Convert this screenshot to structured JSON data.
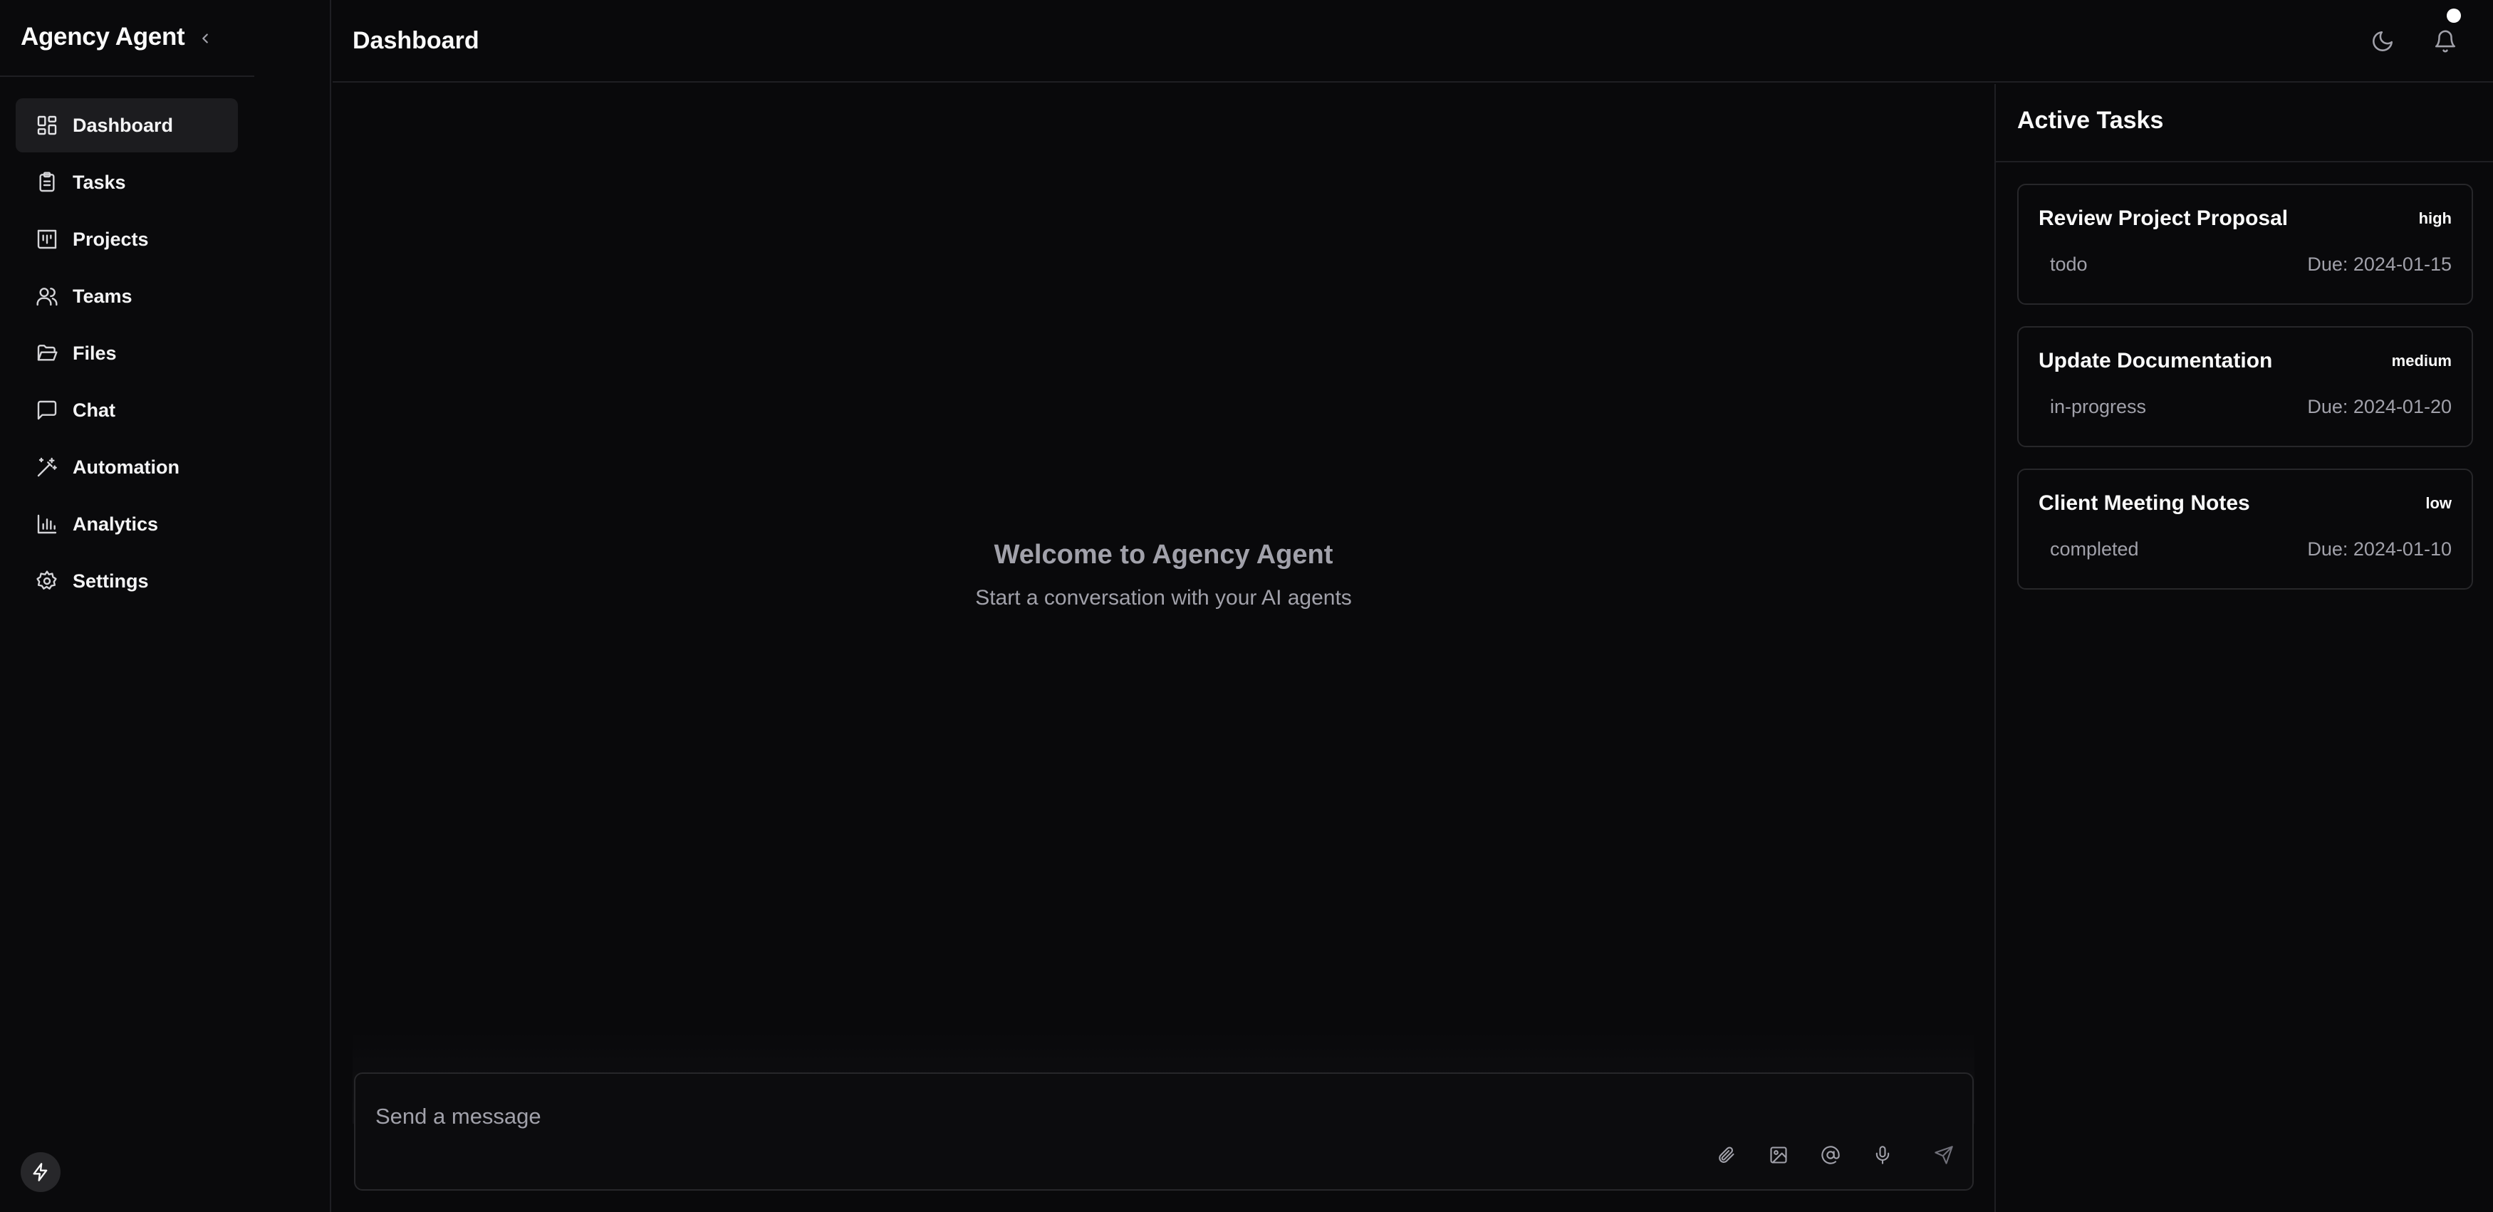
{
  "sidebar": {
    "app_name": "Agency Agent",
    "items": [
      {
        "label": "Dashboard",
        "icon": "layout-dashboard-icon",
        "active": true
      },
      {
        "label": "Tasks",
        "icon": "clipboard-list-icon"
      },
      {
        "label": "Projects",
        "icon": "kanban-chart-icon"
      },
      {
        "label": "Teams",
        "icon": "users-icon"
      },
      {
        "label": "Files",
        "icon": "folder-open-icon"
      },
      {
        "label": "Chat",
        "icon": "message-square-icon"
      },
      {
        "label": "Automation",
        "icon": "wand-icon"
      },
      {
        "label": "Analytics",
        "icon": "bar-chart-icon"
      },
      {
        "label": "Settings",
        "icon": "gear-icon"
      }
    ]
  },
  "header": {
    "title": "Dashboard",
    "theme_icon": "moon-icon",
    "notifications_icon": "bell-icon"
  },
  "chat": {
    "welcome_title": "Welcome to Agency Agent",
    "welcome_subtitle": "Start a conversation with your AI agents",
    "input_placeholder": "Send a message",
    "tools": [
      "paperclip-icon",
      "image-icon",
      "at-sign-icon",
      "microphone-icon",
      "send-icon"
    ]
  },
  "tasks": {
    "title": "Active Tasks",
    "items": [
      {
        "title": "Review Project Proposal",
        "priority": "high",
        "status": "todo",
        "due": "Due: 2024-01-15"
      },
      {
        "title": "Update Documentation",
        "priority": "medium",
        "status": "in-progress",
        "due": "Due: 2024-01-20"
      },
      {
        "title": "Client Meeting Notes",
        "priority": "low",
        "status": "completed",
        "due": "Due: 2024-01-10"
      }
    ]
  },
  "colors": {
    "background": "#09090b",
    "border": "#1f1f23",
    "active_nav": "#1c1c1f",
    "muted_text": "#a1a1aa"
  }
}
